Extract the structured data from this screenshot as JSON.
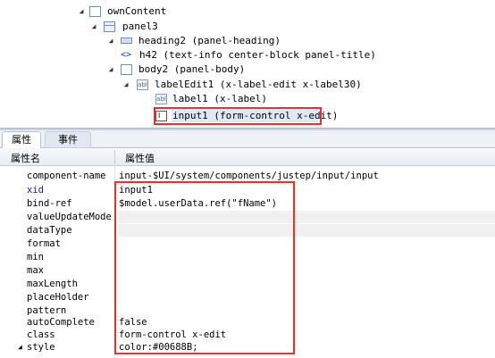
{
  "tree": {
    "nodes": [
      {
        "label": "ownContent",
        "icon": "component-box-icon"
      },
      {
        "label": "panel3",
        "icon": "panel-icon"
      },
      {
        "label": "heading2 (panel-heading)",
        "icon": "heading-icon"
      },
      {
        "label": "h42 (text-info center-block panel-title)",
        "icon": "code-tag-icon"
      },
      {
        "label": "body2 (panel-body)",
        "icon": "component-box-icon"
      },
      {
        "label": "labelEdit1 (x-label-edit x-label30)",
        "icon": "label-edit-icon"
      },
      {
        "label": "label1 (x-label)",
        "icon": "label-icon"
      },
      {
        "label": "input1 (form-control x-edit)",
        "icon": "input-icon"
      }
    ],
    "selected": "input1 (form-control x-edit)"
  },
  "tabs": [
    {
      "label": "属性",
      "active": true
    },
    {
      "label": "事件",
      "active": false
    }
  ],
  "grid": {
    "header_name": "属性名",
    "header_value": "属性值",
    "rows": [
      {
        "name": "component-name",
        "value": "input-$UI/system/components/justep/input/input"
      },
      {
        "name": "xid",
        "value": "input1",
        "name_color": "#1a1aa6"
      },
      {
        "name": "bind-ref",
        "value": "$model.userData.ref(\"fName\")"
      },
      {
        "name": "valueUpdateMode",
        "value": ""
      },
      {
        "name": "dataType",
        "value": ""
      },
      {
        "name": "format",
        "value": ""
      },
      {
        "name": "min",
        "value": ""
      },
      {
        "name": "max",
        "value": ""
      },
      {
        "name": "maxLength",
        "value": ""
      },
      {
        "name": "placeHolder",
        "value": ""
      },
      {
        "name": "pattern",
        "value": ""
      },
      {
        "name": "autoComplete",
        "value": "false"
      },
      {
        "name": "class",
        "value": "form-control x-edit"
      },
      {
        "name": "style",
        "value": "color:#00688B;"
      }
    ]
  },
  "colors": {
    "highlight": "#e53030",
    "selection_bg": "#dfe9f6"
  }
}
